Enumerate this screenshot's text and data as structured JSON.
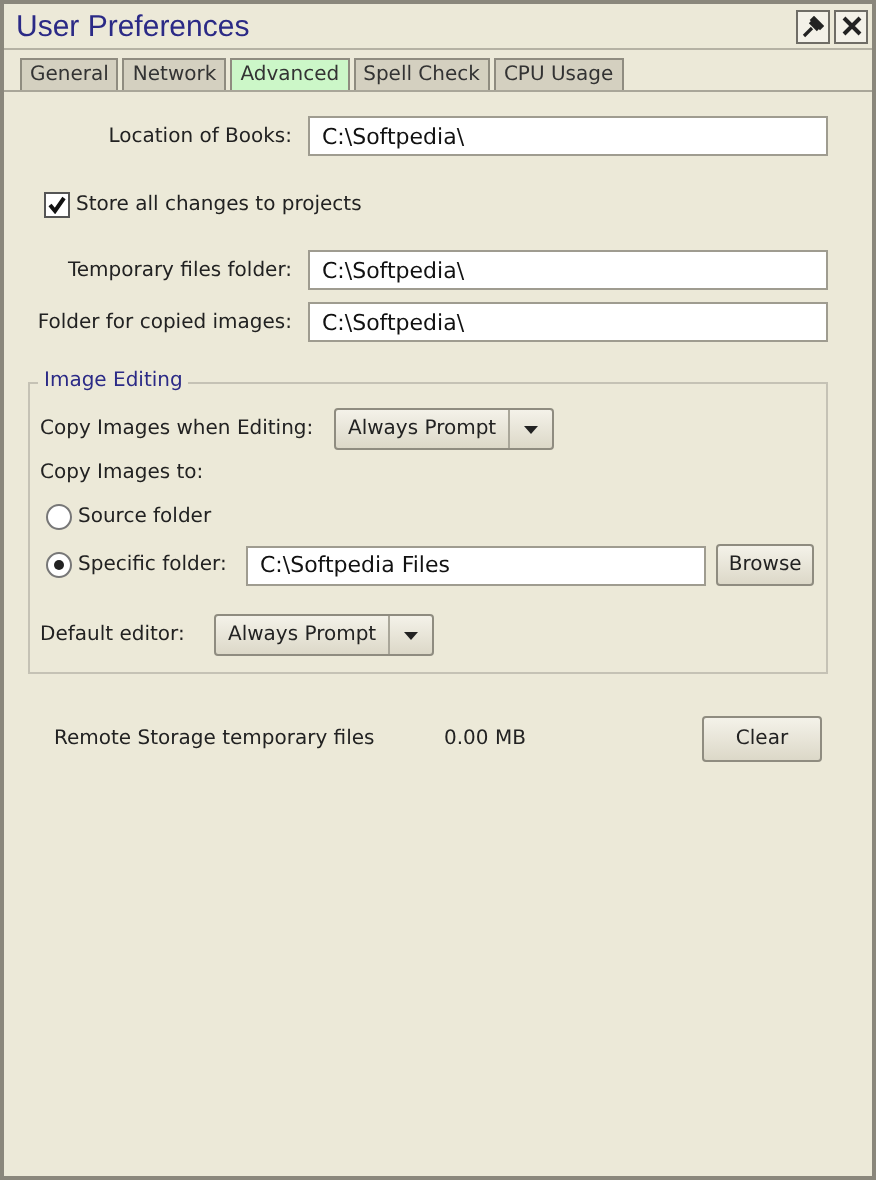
{
  "window": {
    "title": "User Preferences"
  },
  "tabs": [
    {
      "label": "General",
      "selected": false
    },
    {
      "label": "Network",
      "selected": false
    },
    {
      "label": "Advanced",
      "selected": true
    },
    {
      "label": "Spell Check",
      "selected": false
    },
    {
      "label": "CPU Usage",
      "selected": false
    }
  ],
  "location_of_books": {
    "label": "Location of Books:",
    "value": "C:\\Softpedia\\"
  },
  "store_changes": {
    "label": "Store all changes to projects",
    "checked": true
  },
  "folders": [
    {
      "label": "Temporary files folder:",
      "value": "C:\\Softpedia\\"
    },
    {
      "label": "Folder for copied images:",
      "value": "C:\\Softpedia\\"
    }
  ],
  "image_editing": {
    "title": "Image Editing",
    "copy_when_editing": {
      "label": "Copy Images when Editing:",
      "value": "Always Prompt"
    },
    "copy_to_label": "Copy Images to:",
    "options": [
      {
        "label": "Source folder",
        "selected": false
      },
      {
        "label": "Specific folder:",
        "selected": true,
        "value": "C:\\Softpedia Files",
        "button": "Browse"
      }
    ],
    "default_editor": {
      "label": "Default editor:",
      "value": "Always Prompt"
    }
  },
  "remote_storage": {
    "label": "Remote Storage temporary files",
    "size": "0.00 MB",
    "button": "Clear"
  }
}
